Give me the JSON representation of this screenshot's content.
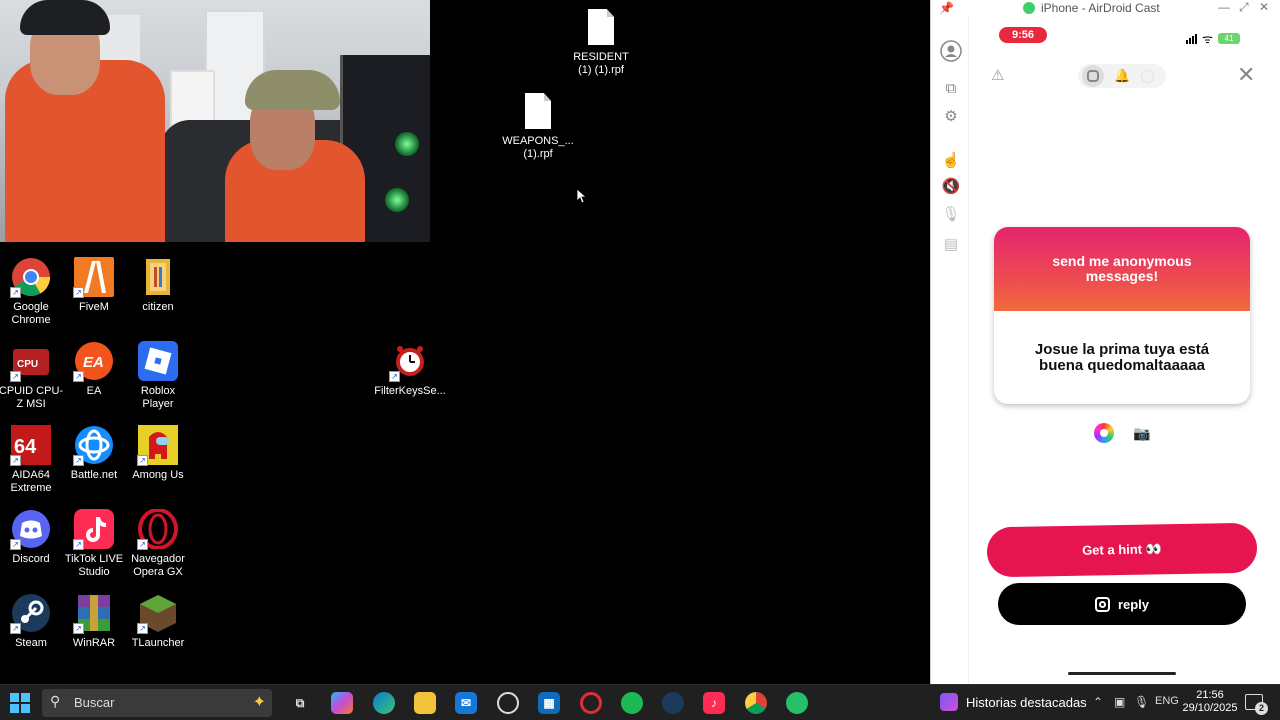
{
  "desktop": {
    "icons": [
      {
        "label": "Google Chrome",
        "icon": "chrome-icon"
      },
      {
        "label": "FiveM",
        "icon": "fivem-icon"
      },
      {
        "label": "citizen",
        "icon": "folder-icon"
      },
      {
        "label": "CPUID CPU-Z MSI",
        "icon": "cpuz-icon"
      },
      {
        "label": "EA",
        "icon": "ea-icon"
      },
      {
        "label": "Roblox Player",
        "icon": "roblox-icon"
      },
      {
        "label": "AIDA64 Extreme",
        "icon": "aida64-icon"
      },
      {
        "label": "Battle.net",
        "icon": "battlenet-icon"
      },
      {
        "label": "Among Us",
        "icon": "amongus-icon"
      },
      {
        "label": "Discord",
        "icon": "discord-icon"
      },
      {
        "label": "TikTok LIVE Studio",
        "icon": "tiktok-icon"
      },
      {
        "label": "Navegador Opera GX",
        "icon": "opera-icon"
      },
      {
        "label": "Steam",
        "icon": "steam-icon"
      },
      {
        "label": "WinRAR",
        "icon": "winrar-icon"
      },
      {
        "label": "TLauncher",
        "icon": "tlauncher-icon"
      },
      {
        "label": "FilterKeysSe...",
        "icon": "alarm-clock-icon"
      }
    ],
    "files": [
      {
        "label": "RESIDENT (1) (1).rpf"
      },
      {
        "label": "WEAPONS_... (1).rpf"
      }
    ]
  },
  "airdroid": {
    "title": "iPhone - AirDroid Cast",
    "phone": {
      "time": "9:56",
      "battery": "41",
      "card_header": "send me anonymous messages!",
      "card_message": "Josue la prima tuya está buena quedomaltaaaaa",
      "hint_button": "Get a hint 👀",
      "reply_button": "reply"
    }
  },
  "taskbar": {
    "search_placeholder": "Buscar",
    "news_label": "Historias destacadas",
    "language": "ENG",
    "time": "21:56",
    "date": "29/10/2025",
    "notification_count": "2"
  },
  "colors": {
    "accent_pink": "#e6154f",
    "time_pill": "#e8283c",
    "card_gradient_start": "#e5246e",
    "card_gradient_end": "#f26b3a",
    "taskbar_bg": "#202020"
  }
}
